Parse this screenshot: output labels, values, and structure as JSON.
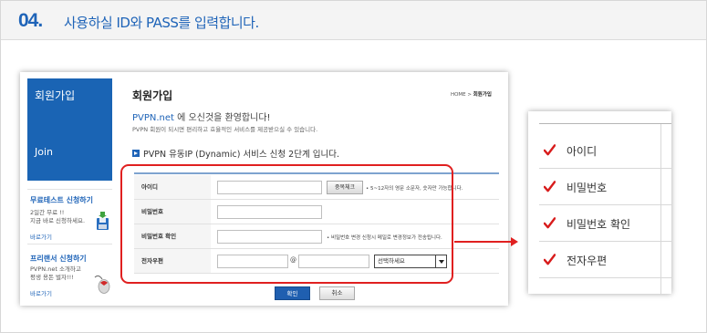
{
  "header": {
    "step_number": "04.",
    "step_title": "사용하실 ID와 PASS를 입력합니다."
  },
  "sidebar": {
    "title": "회원가입",
    "join": "Join",
    "promos": [
      {
        "title": "무료테스트 신청하기",
        "text": "2일간 무료 !!\n지금 바로 신청하세요.",
        "link": "바로가기"
      },
      {
        "title": "프리랜서 신청하기",
        "text": "PVPN.net 소개하고\n평생 용돈 벌자!!!",
        "link": "바로가기"
      }
    ]
  },
  "main": {
    "title": "회원가입",
    "breadcrumb_home": "HOME",
    "breadcrumb_sep": ">",
    "breadcrumb_current": "회원가입",
    "welcome_brand": "PVPN.net",
    "welcome_rest": " 에 오신것을 환영합니다!",
    "description": "PVPN 회원이 되시면 편리하고 효율적인 서비스를 제공받으실 수 있습니다.",
    "step_text": "PVPN 유동IP (Dynamic) 서비스 신청 2단계 입니다."
  },
  "form": {
    "id_label": "아이디",
    "id_value": "",
    "dup_check_button": "중복체크",
    "id_hint": "• 5~12자의 영문 소문자, 숫자만 가능합니다.",
    "pw_label": "비밀번호",
    "pw_value": "",
    "pw_confirm_label": "비밀번호 확인",
    "pw_confirm_value": "",
    "pw_hint": "• 비밀번호 변경 신청시 메일로 변경정보가 전송됩니다.",
    "email_label": "전자우편",
    "email_user_value": "",
    "email_at": "@",
    "email_domain_value": "",
    "email_select_value": "선택하세요",
    "confirm_button": "확인",
    "cancel_button": "취소"
  },
  "zoom": {
    "items": [
      "아이디",
      "비밀번호",
      "비밀번호 확인",
      "전자우편"
    ]
  },
  "colors": {
    "accent_blue": "#1f64b8",
    "highlight_red": "#e02020",
    "check_red": "#d81c1c"
  },
  "icons": {
    "promo1": "floppy-disk-icon",
    "promo2": "mouse-icon",
    "check": "check-mark-icon",
    "step_bullet": "play-bullet-icon"
  }
}
